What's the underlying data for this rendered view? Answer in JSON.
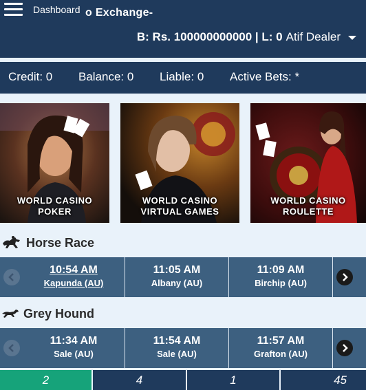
{
  "header": {
    "menu_icon": "hamburger-menu-icon",
    "dashboard_label": "Dashboard",
    "brand": "o Exchange-",
    "balance_text": "B: Rs. 100000000000 | L: 0",
    "username": "Atif Dealer"
  },
  "status": {
    "credit": "Credit: 0",
    "balance": "Balance: 0",
    "liable": "Liable: 0",
    "active_bets": "Active Bets: *"
  },
  "casino_tiles": [
    {
      "line1": "WORLD CASINO",
      "line2": "POKER"
    },
    {
      "line1": "WORLD CASINO",
      "line2": "VIRTUAL GAMES"
    },
    {
      "line1": "WORLD CASINO",
      "line2": "ROULETTE"
    }
  ],
  "horse_race": {
    "icon": "horse-icon",
    "title": "Horse Race",
    "races": [
      {
        "time": "10:54 AM",
        "venue": "Kapunda (AU)"
      },
      {
        "time": "11:05 AM",
        "venue": "Albany (AU)"
      },
      {
        "time": "11:09 AM",
        "venue": "Birchip (AU)"
      }
    ]
  },
  "grey_hound": {
    "icon": "greyhound-icon",
    "title": "Grey Hound",
    "races": [
      {
        "time": "11:34 AM",
        "venue": "Sale (AU)"
      },
      {
        "time": "11:54 AM",
        "venue": "Sale (AU)"
      },
      {
        "time": "11:57 AM",
        "venue": "Grafton (AU)"
      }
    ]
  },
  "bottom_tabs": [
    "2",
    "4",
    "1",
    "45"
  ],
  "colors": {
    "header_bg": "#1f3a5c",
    "race_row_bg": "#3d6080",
    "active_tab": "#16a37a",
    "tab_bg": "#1f3a5c"
  }
}
